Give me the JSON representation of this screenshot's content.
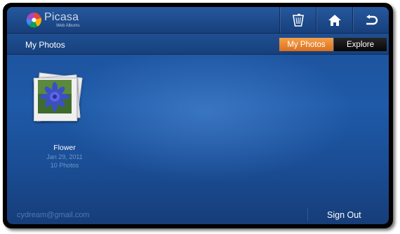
{
  "app": {
    "name": "Picasa",
    "subtitle": "Web Albums"
  },
  "topbar": {
    "icons": [
      "trash-icon",
      "home-icon",
      "back-icon"
    ]
  },
  "header": {
    "title": "My Photos",
    "tabs": [
      {
        "label": "My Photos",
        "active": true
      },
      {
        "label": "Explore",
        "active": false
      }
    ]
  },
  "albums": [
    {
      "name": "Flower",
      "date": "Jan 29, 2011",
      "count": "10 Photos"
    }
  ],
  "footer": {
    "email": "cydream@gmail.com",
    "sign_out": "Sign Out"
  },
  "colors": {
    "active_tab": "#ee8a2f",
    "background": "#1e5aa8"
  }
}
